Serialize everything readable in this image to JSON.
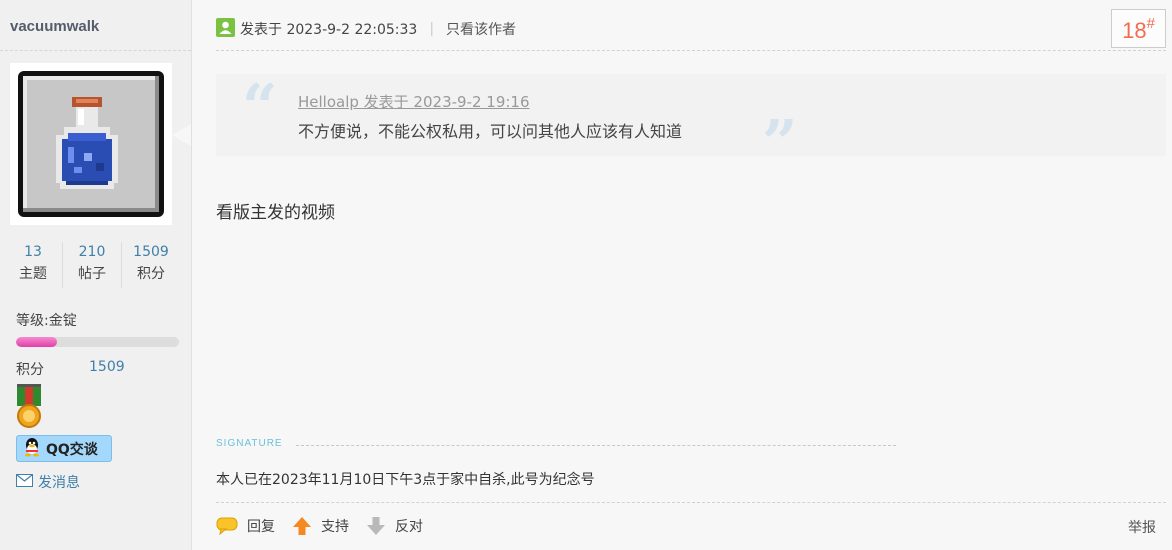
{
  "sidebar": {
    "username": "vacuumwalk",
    "avatar": "potion-bottle-pixel-icon",
    "stats": [
      {
        "num": "13",
        "label": "主题"
      },
      {
        "num": "210",
        "label": "帖子"
      },
      {
        "num": "1509",
        "label": "积分"
      }
    ],
    "level_text": "等级:金锭",
    "level_progress": 0.25,
    "points_label": "积分",
    "points_value": "1509",
    "medal_icon": "medal-icon",
    "qq_label": "QQ交谈",
    "message_label": "发消息"
  },
  "post": {
    "posted_label": "发表于 2023-9-2 22:05:33",
    "separator": "|",
    "only_author": "只看该作者",
    "floor_number": "18",
    "floor_mark": "#",
    "quote": {
      "author_line": "Helloalp 发表于 2023-9-2 19:16",
      "text": "不方便说，不能公权私用，可以问其他人应该有人知道"
    },
    "body": "看版主发的视频",
    "signature_title": "SIGNATURE",
    "signature_text": "本人已在2023年11月10日下午3点于家中自杀,此号为纪念号"
  },
  "actions": {
    "reply": "回复",
    "support": "支持",
    "oppose": "反对",
    "report": "举报"
  },
  "colors": {
    "accent_link": "#3f7fa8",
    "floor_number": "#f36c4e",
    "level_bar": "#e13fa8",
    "qq_button": "#a3d7fb"
  }
}
